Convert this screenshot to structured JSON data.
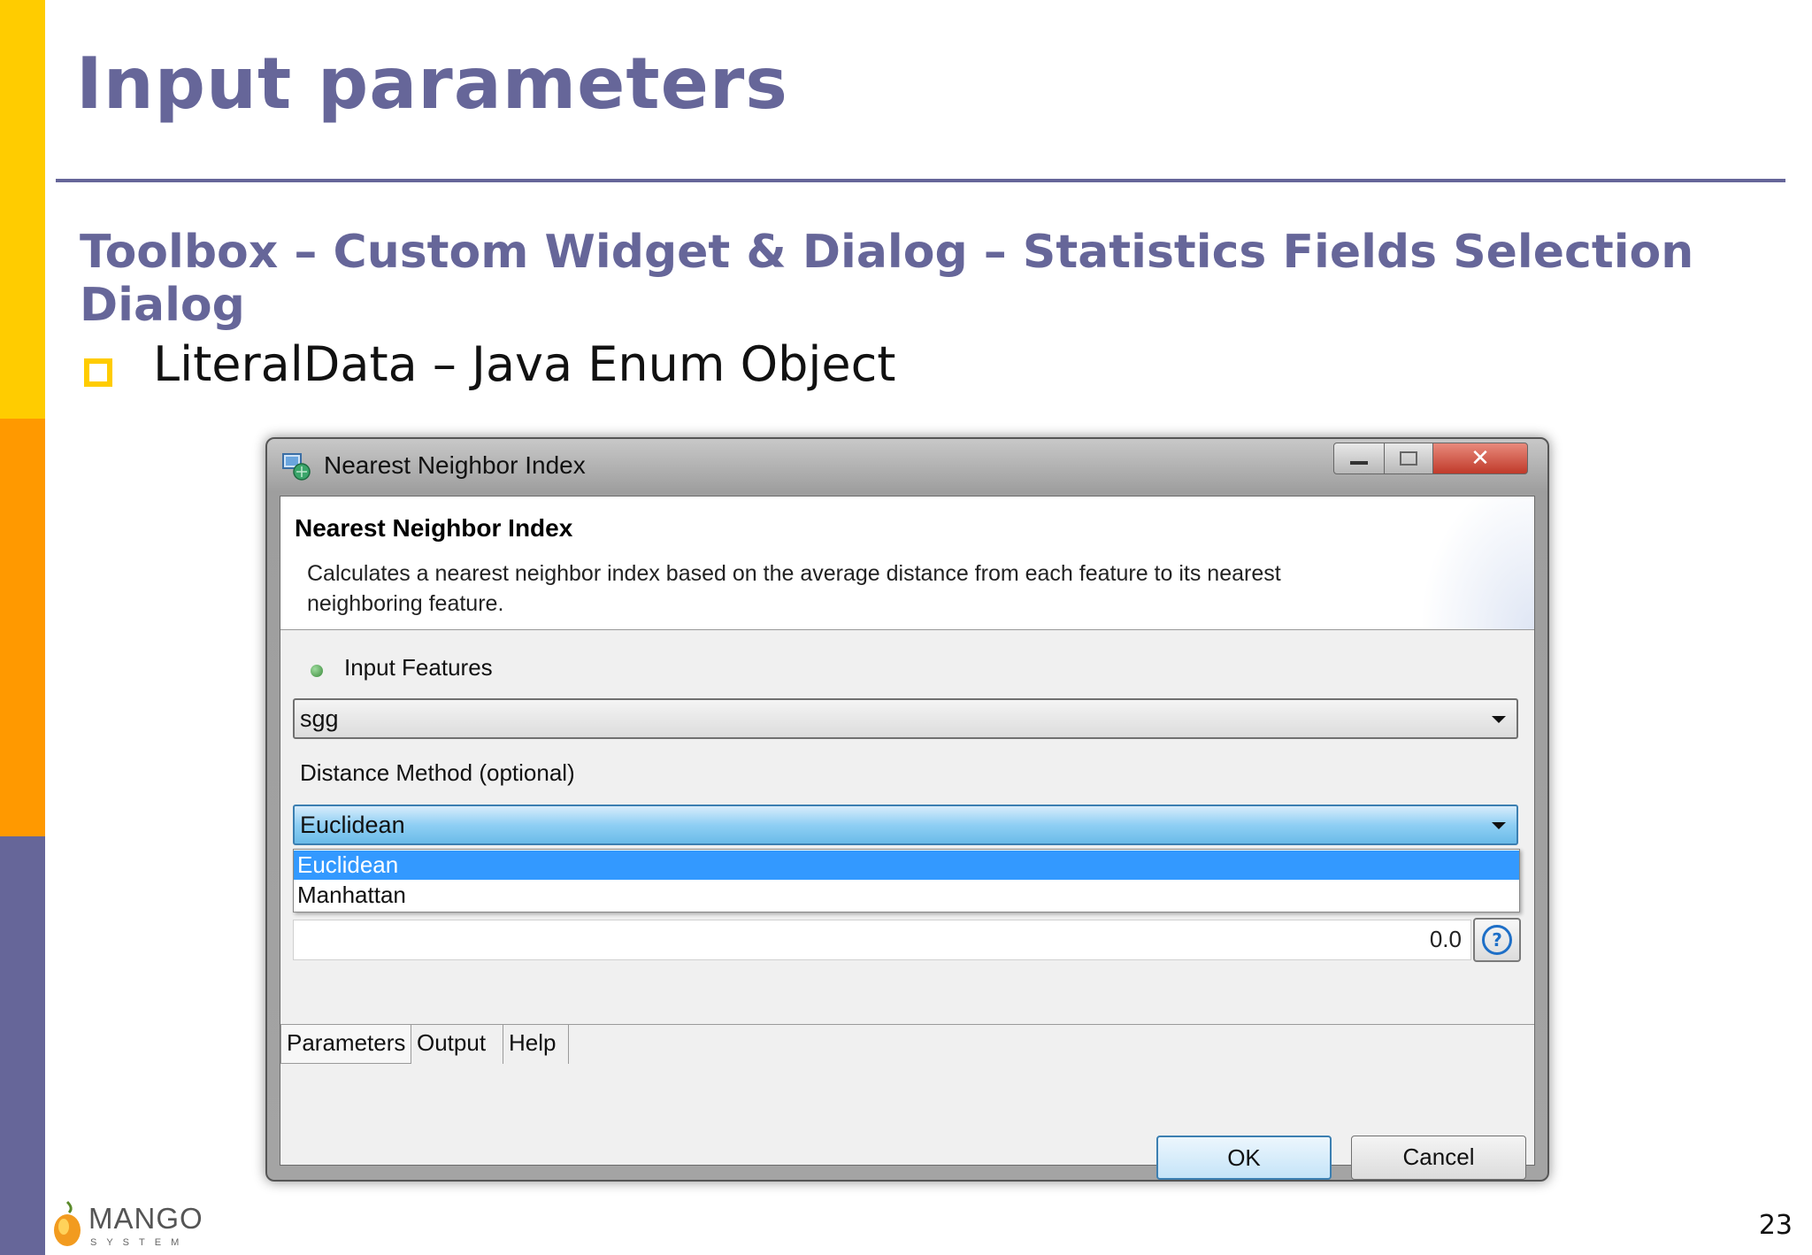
{
  "slide": {
    "title": "Input parameters",
    "subtitle": "Toolbox – Custom Widget & Dialog – Statistics Fields Selection Dialog",
    "bullet": "LiteralData – Java Enum Object",
    "page_number": "23",
    "logo": {
      "word": "MANGO",
      "sub": "SYSTEM"
    }
  },
  "window": {
    "title": "Nearest Neighbor Index",
    "controls": {
      "minimize": "minimize-icon",
      "maximize": "maximize-icon",
      "close": "close-icon"
    },
    "header": {
      "title": "Nearest Neighbor Index",
      "description": "Calculates a nearest neighbor index based on the average distance from each feature to its nearest neighboring feature."
    },
    "fields": {
      "input_features": {
        "label": "Input Features",
        "value": "sgg"
      },
      "distance_method": {
        "label": "Distance Method (optional)",
        "value": "Euclidean",
        "options": [
          "Euclidean",
          "Manhattan"
        ]
      },
      "number_value": "0.0"
    },
    "tabs": [
      "Parameters",
      "Output",
      "Help"
    ],
    "buttons": {
      "ok": "OK",
      "cancel": "Cancel"
    }
  },
  "colors": {
    "accent": "#666699",
    "bar_yellow": "#ffcc00",
    "bar_orange": "#ff9900",
    "selection": "#3399ff"
  }
}
